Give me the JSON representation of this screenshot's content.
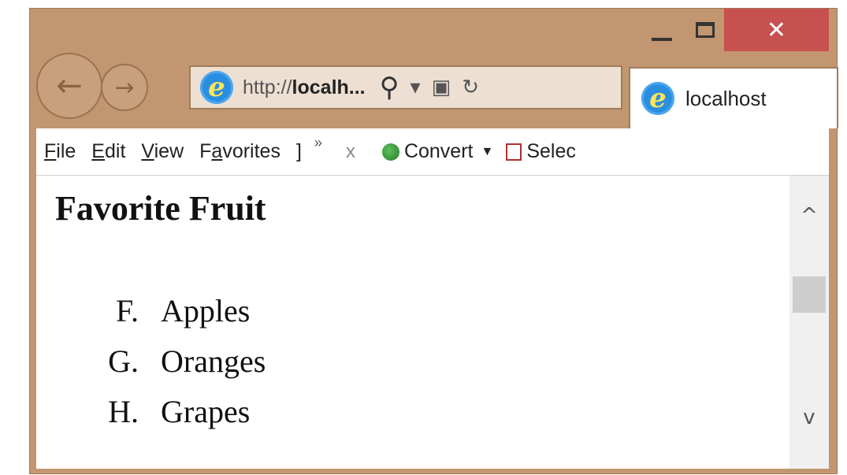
{
  "window": {
    "minimize_glyph": "_",
    "close_glyph": "✕"
  },
  "nav": {
    "back_glyph": "←",
    "forward_glyph": "→"
  },
  "address_bar": {
    "url_prefix": "http://",
    "url_host": "localh...",
    "search_glyph": "⚲",
    "dropdown_glyph": "▾",
    "compat_glyph": "▣",
    "refresh_glyph": "↻"
  },
  "tab": {
    "title": "localhost"
  },
  "menubar": {
    "items": [
      {
        "prefix": "",
        "accel": "F",
        "rest": "ile"
      },
      {
        "prefix": "",
        "accel": "E",
        "rest": "dit"
      },
      {
        "prefix": "",
        "accel": "V",
        "rest": "iew"
      },
      {
        "prefix": "F",
        "accel": "a",
        "rest": "vorites"
      },
      {
        "prefix": "",
        "accel": "]",
        "rest": ""
      }
    ],
    "chevron": "»",
    "close_toolbar": "x",
    "convert_label": "Convert",
    "convert_caret": "▼",
    "select_label": "Selec"
  },
  "page": {
    "heading": "Favorite Fruit",
    "list": [
      {
        "marker": "F.",
        "name": "Apples"
      },
      {
        "marker": "G.",
        "name": "Oranges"
      },
      {
        "marker": "H.",
        "name": "Grapes"
      }
    ]
  },
  "scrollbar": {
    "up_glyph": "^",
    "down_glyph": "v"
  },
  "colors": {
    "frame": "#c29670",
    "close_button": "#c75050",
    "ie_logo": "#2a8ee0"
  }
}
